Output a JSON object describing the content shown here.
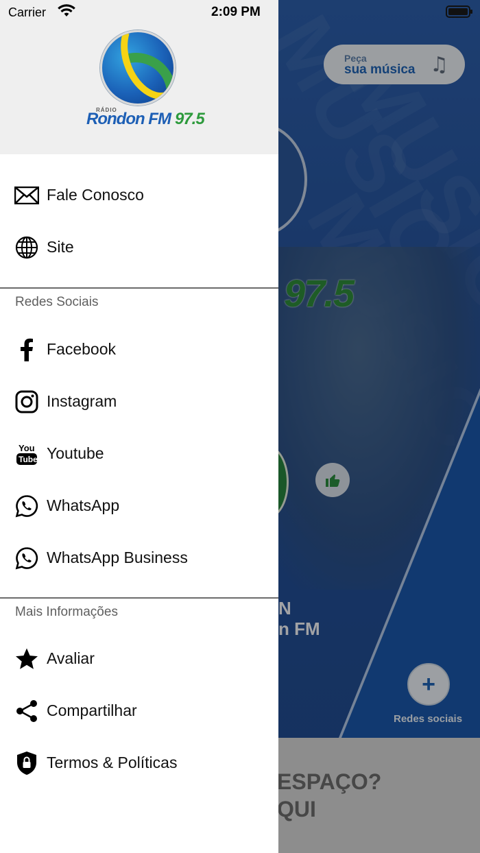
{
  "status_bar": {
    "carrier": "Carrier",
    "time": "2:09 PM"
  },
  "drawer": {
    "logo": {
      "small_text": "RÁDIO",
      "brand_name": "Rondon FM",
      "brand_freq": "97.5"
    },
    "primary_items": [
      {
        "label": "Fale Conosco",
        "icon": "envelope-icon"
      },
      {
        "label": "Site",
        "icon": "globe-icon"
      }
    ],
    "sections": [
      {
        "title": "Redes Sociais",
        "items": [
          {
            "label": "Facebook",
            "icon": "facebook-icon"
          },
          {
            "label": "Instagram",
            "icon": "instagram-icon"
          },
          {
            "label": "Youtube",
            "icon": "youtube-icon"
          },
          {
            "label": "WhatsApp",
            "icon": "whatsapp-icon"
          },
          {
            "label": "WhatsApp Business",
            "icon": "whatsapp-business-icon"
          }
        ]
      },
      {
        "title": "Mais Informações",
        "items": [
          {
            "label": "Avaliar",
            "icon": "star-icon"
          },
          {
            "label": "Compartilhar",
            "icon": "share-icon"
          },
          {
            "label": "Termos & Políticas",
            "icon": "shield-lock-icon"
          }
        ]
      }
    ]
  },
  "background": {
    "request_button": {
      "line1": "Peça",
      "line2": "sua música"
    },
    "logo_freq": "97.5",
    "station_line1": "N",
    "station_line2": "n FM",
    "social_button_label": "Redes sociais",
    "banner_line1": "ESPAÇO?",
    "banner_line2": "QUI",
    "pattern_text": "MUSIC"
  },
  "colors": {
    "accent_blue": "#1f62b2",
    "brand_green": "#2d9a3c",
    "drawer_header_bg": "#efefef"
  }
}
